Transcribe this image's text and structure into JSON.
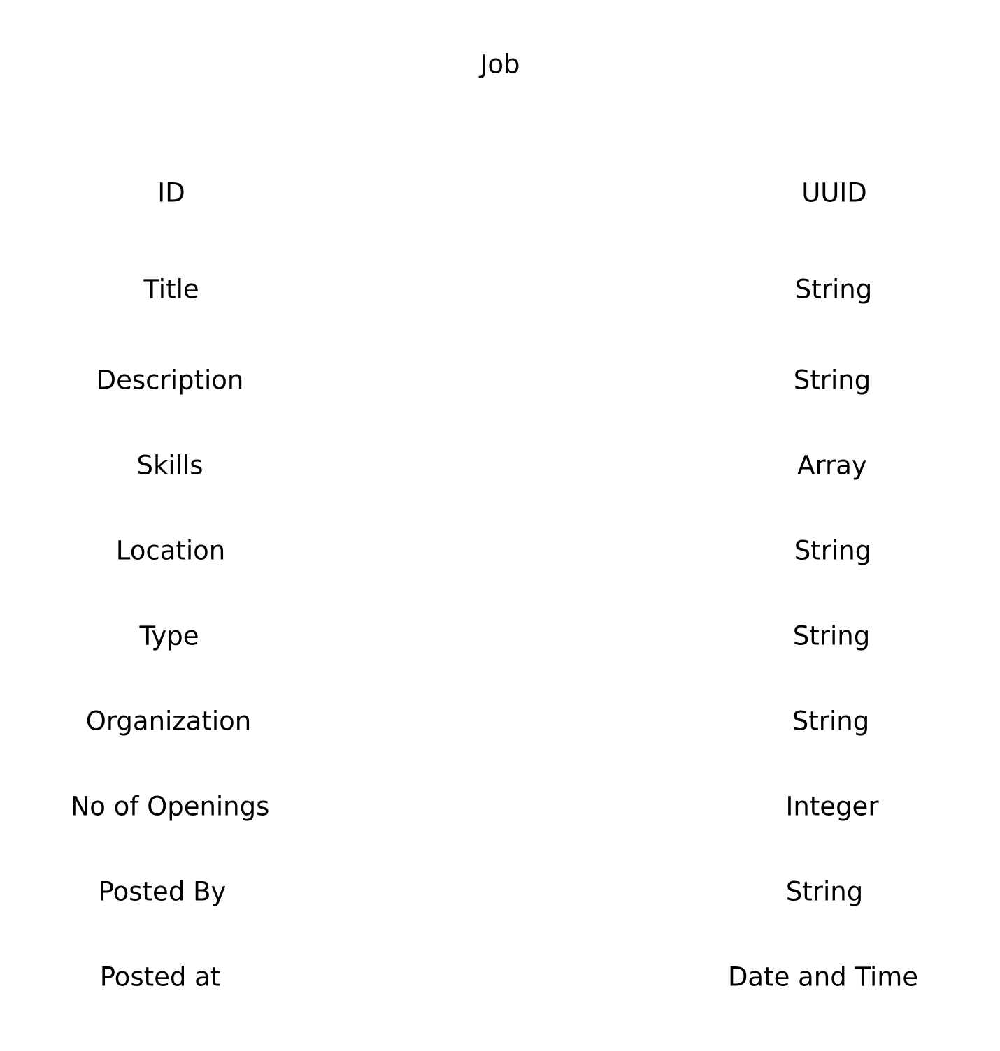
{
  "entity": {
    "title": "Job",
    "fields": [
      {
        "name": "ID",
        "type": "UUID"
      },
      {
        "name": "Title",
        "type": "String"
      },
      {
        "name": "Description",
        "type": "String"
      },
      {
        "name": "Skills",
        "type": "Array"
      },
      {
        "name": "Location",
        "type": "String"
      },
      {
        "name": "Type",
        "type": "String"
      },
      {
        "name": "Organization",
        "type": "String"
      },
      {
        "name": "No of Openings",
        "type": "Integer"
      },
      {
        "name": "Posted By",
        "type": "String"
      },
      {
        "name": "Posted at",
        "type": "Date and Time"
      }
    ]
  }
}
